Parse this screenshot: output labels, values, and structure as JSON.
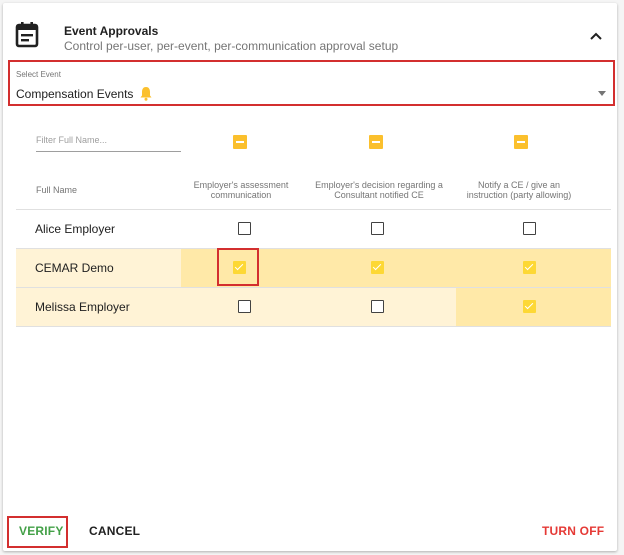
{
  "header": {
    "title": "Event Approvals",
    "subtitle": "Control per-user, per-event, per-communication approval setup"
  },
  "select_event": {
    "label": "Select Event",
    "value": "Compensation Events"
  },
  "filter": {
    "placeholder": "Filter Full Name..."
  },
  "table": {
    "name_header": "Full Name",
    "columns": [
      {
        "line1": "Employer's assessment",
        "line2": "communication"
      },
      {
        "line1": "Employer's decision regarding a",
        "line2": "Consultant notified CE"
      },
      {
        "line1": "Notify a CE / give an",
        "line2": "instruction (party allowing)"
      }
    ],
    "rows": [
      {
        "name": "Alice Employer",
        "checks": [
          false,
          false,
          false
        ]
      },
      {
        "name": "CEMAR Demo",
        "checks": [
          true,
          true,
          true
        ]
      },
      {
        "name": "Melissa Employer",
        "checks": [
          false,
          false,
          true
        ]
      }
    ]
  },
  "footer": {
    "verify": "VERIFY",
    "cancel": "CANCEL",
    "turn_off": "TURN OFF"
  },
  "colors": {
    "accent_yellow": "#fbc02d",
    "row_highlight": "#fff3d6",
    "cell_highlight": "#ffe9a8",
    "verify_green": "#43a047",
    "turn_off_red": "#e53935",
    "annotation_red": "#d32f2f"
  }
}
